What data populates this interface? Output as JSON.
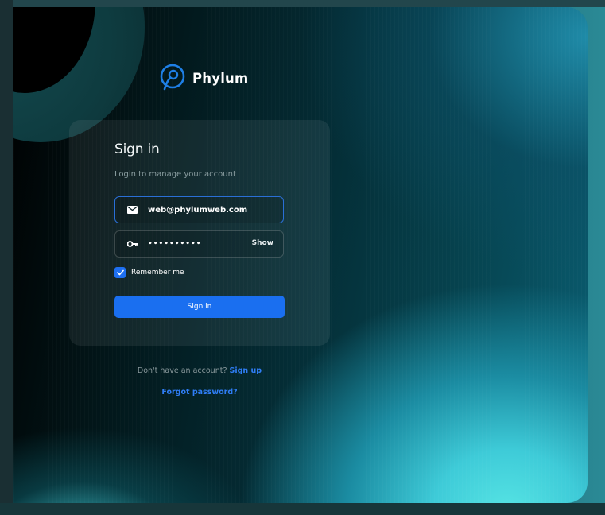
{
  "brand": {
    "name": "Phylum",
    "accent": "#1a6ff0"
  },
  "card": {
    "title": "Sign in",
    "subtitle": "Login to manage your account"
  },
  "email_field": {
    "icon": "mail-icon",
    "value": "web@phylumweb.com"
  },
  "password_field": {
    "icon": "key-icon",
    "value": "••••••••••",
    "show_label": "Show"
  },
  "remember": {
    "label": "Remember me",
    "checked": true
  },
  "signin_button": {
    "label": "Sign in"
  },
  "footer": {
    "no_account_text": "Don't have an account?",
    "signup_label": "Sign up",
    "forgot_label": "Forgot password?"
  }
}
